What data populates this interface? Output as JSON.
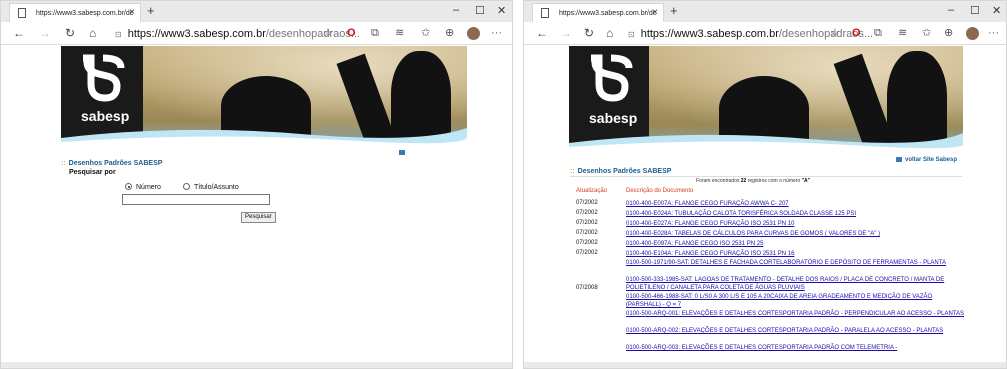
{
  "windows": [
    {
      "tab_title": "https://www3.sabesp.com.br/dc",
      "new_tab": "+",
      "url_host": "https://www3.sabesp.com.br",
      "url_path": "/desenhopadraos...",
      "controls": {
        "minimize": "–",
        "maximize": "☐",
        "close": "✕"
      },
      "section_title": "Desenhos Padrões SABESP",
      "section_prefix": "::",
      "voltar": "",
      "search_heading": "Pesquisar por",
      "radio_numero": "Número",
      "radio_titulo": "Título/Assunto",
      "search_value": "",
      "search_button": "Pesquisar"
    },
    {
      "tab_title": "https://www3.sabesp.com.br/dc",
      "new_tab": "+",
      "url_host": "https://www3.sabesp.com.br",
      "url_path": "/desenhopadraos...",
      "controls": {
        "minimize": "–",
        "maximize": "☐",
        "close": "✕"
      },
      "section_title": "Desenhos Padrões SABESP",
      "section_prefix": "::",
      "voltar": "voltar Site Sabesp",
      "found_prefix": "Foram encontrados",
      "found_count": "22",
      "found_middle": "registros com o número",
      "found_query": "\"A\"",
      "col_date": "Atualização",
      "col_desc": "Descrição do Documento",
      "rows": [
        {
          "date": "07/2002",
          "desc": "0100-400-E007A: FLANGE CEGO FURAÇÃO AWWA C- 207"
        },
        {
          "date": "07/2002",
          "desc": "0100-400-E024A: TUBULAÇÃO CALOTA TORISFÉRICA SOLDADA CLASSE 125 PSI"
        },
        {
          "date": "07/2002",
          "desc": "0100-400-E027A: FLANGE CEGO FURAÇÃO ISO 2531 PN 10"
        },
        {
          "date": "07/2002",
          "desc": "0100-400-E028A: TABELAS DE CÁLCULOS PARA CURVAS DE GOMOS ( VALORES DE \"A\" )"
        },
        {
          "date": "07/2002",
          "desc": "0100-400-E097A: FLANGE CEGO ISO 2531 PN 25"
        },
        {
          "date": "07/2002",
          "desc": "0100-400-E104A: FLANGE CEGO FURAÇÃO ISO 2531 PN 16"
        },
        {
          "date": "",
          "desc": "0100-500-1971/90-SAT: DETALHES E FACHADA CORTELABORATÓRIO E DEPÓSITO DE FERRAMENTAS - PLANTA"
        },
        {
          "date": "",
          "desc": "0100-500-333-1985-SAT: LAGOAS DE TRATAMENTO - DETALHE DOS RAIOS / PLACA DE CONCRETO / MANTA DE POLIETILENO / CANALETA PARA COLETA DE ÁGUAS PLUVIAIS"
        },
        {
          "date": "07/2008",
          "desc": "0100-500-466-1988-SAT: 0 L/S0 A 300 L/S E 105 A 20CAIXA DE AREIA GRADEAMENTO E MEDIÇÃO DE VAZÃO (PARSHALL) - Q = 7"
        },
        {
          "date": "",
          "desc": "0100-500-ARQ-001: ELEVAÇÕES E DETALHES CORTESPORTARIA PADRÃO - PERPENDICULAR AO ACESSO - PLANTAS"
        },
        {
          "date": "",
          "desc": "0100-500-ARQ-002: ELEVAÇÕES E DETALHES CORTESPORTARIA PADRÃO - PARALELA AO ACESSO - PLANTAS"
        },
        {
          "date": "",
          "desc": "0100-500-ARQ-003: ELEVAÇÕES E DETALHES CORTESPORTARIA PADRÃO COM TELEMETRIA -"
        }
      ]
    }
  ],
  "banner": {
    "logo_text": "sabesp"
  },
  "icons": {
    "back": "←",
    "forward": "→",
    "reload": "↻",
    "home": "⌂",
    "lock": "🔒",
    "star": "☆",
    "opera": "O",
    "ext1": "⧉",
    "ext2": "≋",
    "favorites": "✩",
    "collections": "⊕",
    "more": "···"
  },
  "colors": {
    "accent": "#1d5d8f",
    "header_red": "#d7391f",
    "link": "#1a0dab",
    "colon": "#e19a2e"
  }
}
